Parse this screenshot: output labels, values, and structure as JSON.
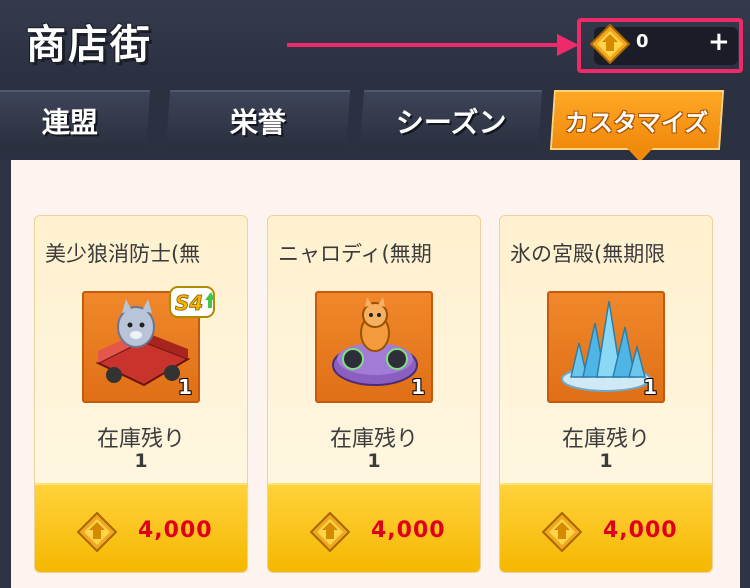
{
  "header": {
    "title": "商店街",
    "currency": {
      "value": "0",
      "plus": "+",
      "icon": "gold-coin-icon",
      "highlight_color": "#ee2a6b"
    }
  },
  "tabs": [
    {
      "label": "連盟",
      "active": false
    },
    {
      "label": "栄誉",
      "active": false
    },
    {
      "label": "シーズン",
      "active": false
    },
    {
      "label": "カスタマイズ",
      "active": true
    }
  ],
  "items": [
    {
      "name": "美少狼消防士(無",
      "quantity": "1",
      "stock_label": "在庫残り",
      "stock": "1",
      "price": "4,000",
      "badge": "S4",
      "image": "fire-truck-wolf-icon"
    },
    {
      "name": "ニャロディ(無期",
      "quantity": "1",
      "stock_label": "在庫残り",
      "stock": "1",
      "price": "4,000",
      "image": "cat-dj-icon"
    },
    {
      "name": "氷の宮殿(無期限",
      "quantity": "1",
      "stock_label": "在庫残り",
      "stock": "1",
      "price": "4,000",
      "image": "ice-palace-icon"
    }
  ],
  "colors": {
    "accent": "#f5a21b",
    "price": "#e0001b",
    "background": "#2f3344"
  }
}
